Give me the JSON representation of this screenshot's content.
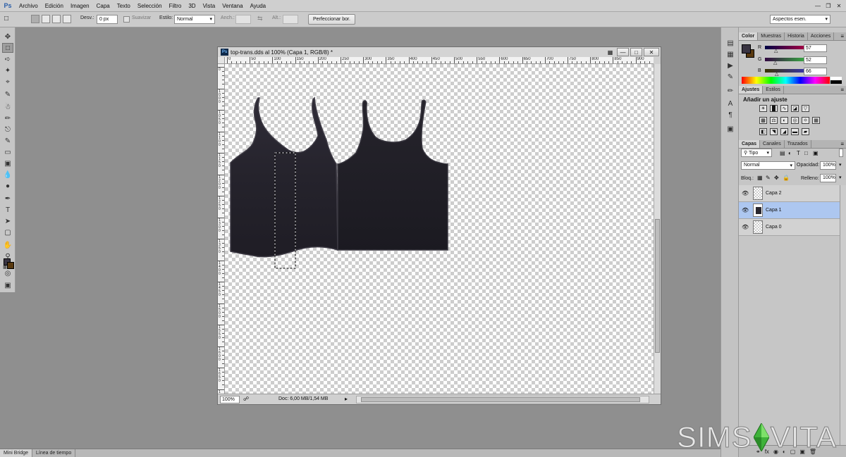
{
  "menubar": {
    "logo": "Ps",
    "items": [
      "Archivo",
      "Edición",
      "Imagen",
      "Capa",
      "Texto",
      "Selección",
      "Filtro",
      "3D",
      "Vista",
      "Ventana",
      "Ayuda"
    ]
  },
  "options": {
    "feather_label": "Desv.:",
    "feather_value": "0 px",
    "antialias_label": "Suavizar",
    "style_label": "Estilo:",
    "style_value": "Normal",
    "width_label": "Anch.:",
    "height_label": "Alt.:",
    "refine_button": "Perfeccionar bor.",
    "workspace": "Aspectos esen."
  },
  "document": {
    "icon": "Ps",
    "title": "top-trans.dds al 100% (Capa 1, RGB/8) *",
    "zoom": "100%",
    "info": "Doc: 6,00 MB/1,54 MB",
    "hruler_labels": [
      "0",
      "50",
      "100",
      "150",
      "200",
      "250",
      "300",
      "350",
      "400",
      "450",
      "500",
      "550",
      "600",
      "650",
      "700",
      "750",
      "800",
      "850",
      "900",
      "950"
    ],
    "vruler_labels": [
      "0",
      "1000",
      "1050",
      "1100",
      "1150",
      "1200",
      "1250",
      "1300",
      "1350",
      "1400",
      "1450",
      "1500",
      "1550",
      "1600",
      "1650",
      "1700"
    ]
  },
  "color_panel": {
    "tabs": [
      "Color",
      "Muestras",
      "Historia",
      "Acciones"
    ],
    "r_label": "R",
    "r_value": "57",
    "g_label": "G",
    "g_value": "52",
    "b_label": "B",
    "b_value": "66",
    "foreground": "#393442",
    "background": "#5a3a10"
  },
  "adjust_panel": {
    "tabs": [
      "Ajustes",
      "Estilos"
    ],
    "title": "Añadir un ajuste"
  },
  "layers_panel": {
    "tabs": [
      "Capas",
      "Canales",
      "Trazados"
    ],
    "filter": "Tipo",
    "blend_mode": "Normal",
    "opacity_label": "Opacidad:",
    "opacity_value": "100%",
    "lock_label": "Bloq.:",
    "fill_label": "Relleno:",
    "fill_value": "100%",
    "layers": [
      {
        "name": "Capa 2",
        "selected": false
      },
      {
        "name": "Capa 1",
        "selected": true
      },
      {
        "name": "Capa 0",
        "selected": false
      }
    ]
  },
  "bottom_tabs": [
    "Mini Bridge",
    "Línea de tiempo"
  ],
  "watermark": {
    "left": "SIMS",
    "right": "VITA"
  }
}
